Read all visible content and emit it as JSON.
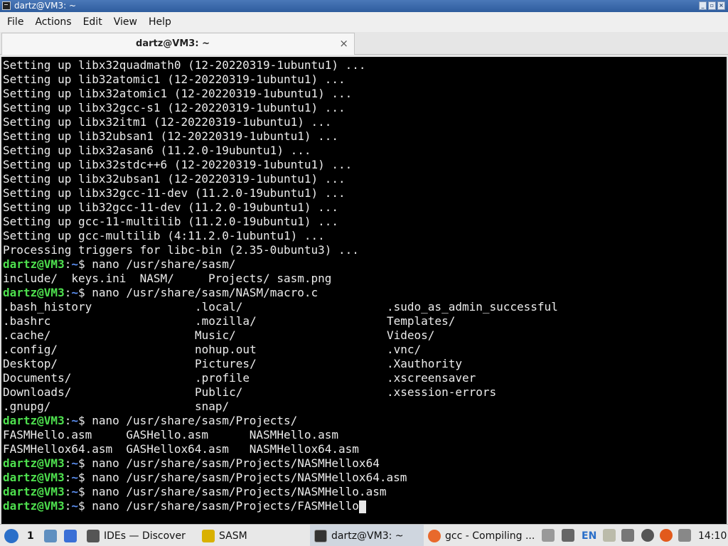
{
  "window": {
    "title": "dartz@VM3: ~",
    "buttons": [
      "_",
      "▫",
      "×"
    ]
  },
  "menu": [
    "File",
    "Actions",
    "Edit",
    "View",
    "Help"
  ],
  "tab": {
    "label": "dartz@VM3: ~",
    "close": "×"
  },
  "terminal": {
    "lines": [
      "Setting up libx32quadmath0 (12-20220319-1ubuntu1) ...",
      "Setting up lib32atomic1 (12-20220319-1ubuntu1) ...",
      "Setting up libx32atomic1 (12-20220319-1ubuntu1) ...",
      "Setting up libx32gcc-s1 (12-20220319-1ubuntu1) ...",
      "Setting up libx32itm1 (12-20220319-1ubuntu1) ...",
      "Setting up lib32ubsan1 (12-20220319-1ubuntu1) ...",
      "Setting up libx32asan6 (11.2.0-19ubuntu1) ...",
      "Setting up libx32stdc++6 (12-20220319-1ubuntu1) ...",
      "Setting up libx32ubsan1 (12-20220319-1ubuntu1) ...",
      "Setting up libx32gcc-11-dev (11.2.0-19ubuntu1) ...",
      "Setting up lib32gcc-11-dev (11.2.0-19ubuntu1) ...",
      "Setting up gcc-11-multilib (11.2.0-19ubuntu1) ...",
      "Setting up gcc-multilib (4:11.2.0-1ubuntu1) ...",
      "Processing triggers for libc-bin (2.35-0ubuntu3) ...",
      {
        "prompt": {
          "user": "dartz@VM3",
          "path": "~"
        },
        "cmd": "$ nano /usr/share/sasm/"
      },
      "include/  keys.ini  NASM/     Projects/ sasm.png",
      {
        "prompt": {
          "user": "dartz@VM3",
          "path": "~"
        },
        "cmd": "$ nano /usr/share/sasm/NASM/macro.c"
      },
      {
        "cols": [
          ".bash_history",
          ".local/",
          ".sudo_as_admin_successful"
        ]
      },
      {
        "cols": [
          ".bashrc",
          ".mozilla/",
          "Templates/"
        ]
      },
      {
        "cols": [
          ".cache/",
          "Music/",
          "Videos/"
        ]
      },
      {
        "cols": [
          ".config/",
          "nohup.out",
          ".vnc/"
        ]
      },
      {
        "cols": [
          "Desktop/",
          "Pictures/",
          ".Xauthority"
        ]
      },
      {
        "cols": [
          "Documents/",
          ".profile",
          ".xscreensaver"
        ]
      },
      {
        "cols": [
          "Downloads/",
          "Public/",
          ".xsession-errors"
        ]
      },
      {
        "cols": [
          ".gnupg/",
          "snap/",
          ""
        ]
      },
      {
        "prompt": {
          "user": "dartz@VM3",
          "path": "~"
        },
        "cmd": "$ nano /usr/share/sasm/Projects/"
      },
      "FASMHello.asm     GASHello.asm      NASMHello.asm",
      "FASMHellox64.asm  GASHellox64.asm   NASMHellox64.asm",
      {
        "prompt": {
          "user": "dartz@VM3",
          "path": "~"
        },
        "cmd": "$ nano /usr/share/sasm/Projects/NASMHellox64"
      },
      {
        "prompt": {
          "user": "dartz@VM3",
          "path": "~"
        },
        "cmd": "$ nano /usr/share/sasm/Projects/NASMHellox64.asm"
      },
      {
        "prompt": {
          "user": "dartz@VM3",
          "path": "~"
        },
        "cmd": "$ nano /usr/share/sasm/Projects/NASMHello.asm"
      },
      {
        "prompt": {
          "user": "dartz@VM3",
          "path": "~"
        },
        "cmd": "$ nano /usr/share/sasm/Projects/FASMHello",
        "cursor": true
      }
    ]
  },
  "taskbar": {
    "workspace": "1",
    "items": [
      {
        "label": "IDEs — Discover",
        "icon": "discover-icon"
      },
      {
        "label": "SASM",
        "icon": "sasm-icon"
      },
      {
        "label": "dartz@VM3: ~",
        "icon": "terminal-icon"
      },
      {
        "label": "gcc - Compiling ...",
        "icon": "firefox-icon"
      }
    ],
    "lang": "EN",
    "clock": "14:10"
  },
  "colors": {
    "prompt_user": "#4ee04e",
    "prompt_path": "#5b8ef0",
    "terminal_bg": "#000000",
    "terminal_fg": "#ececec"
  }
}
